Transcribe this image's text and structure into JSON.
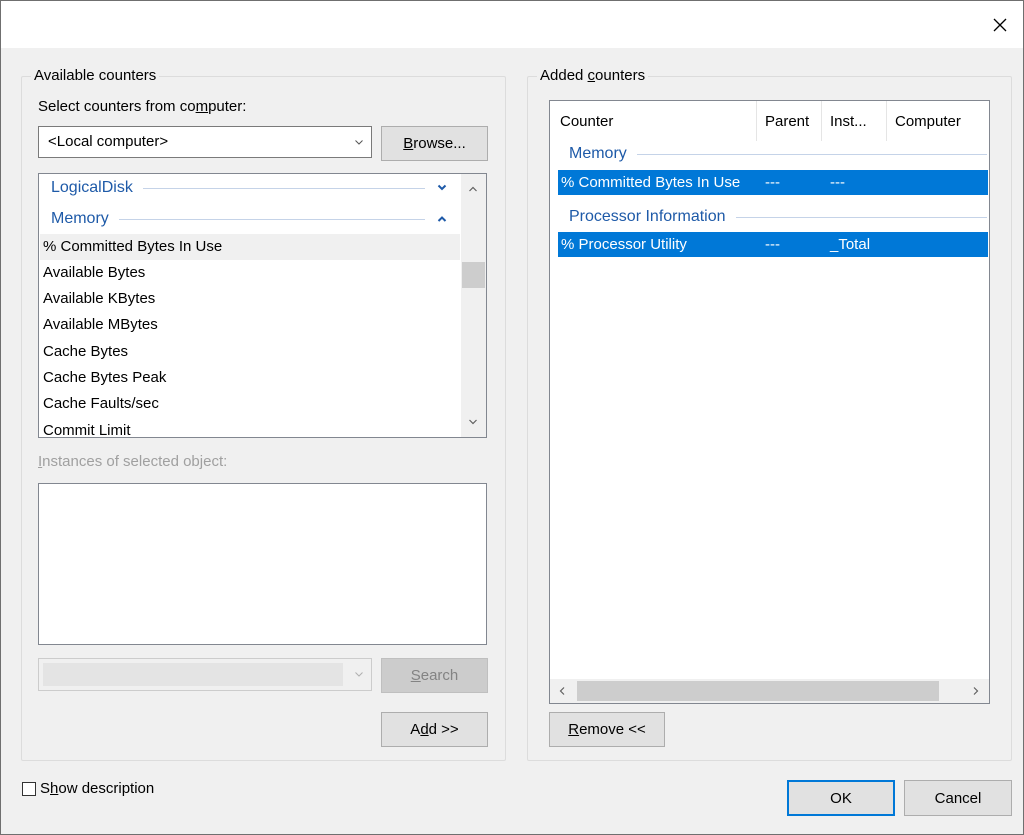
{
  "close_icon": "close-icon",
  "available": {
    "group_label": "Available counters",
    "select_label_pre": "Select counters from co",
    "select_label_ul": "m",
    "select_label_post": "puter:",
    "computer_value": "<Local computer>",
    "browse_pre": "",
    "browse_ul": "B",
    "browse_post": "rowse...",
    "groups": [
      {
        "name": "LogicalDisk",
        "chevron": "chevron-down-icon"
      },
      {
        "name": "Memory",
        "chevron": "chevron-up-icon"
      }
    ],
    "items": [
      "% Committed Bytes In Use",
      "Available Bytes",
      "Available KBytes",
      "Available MBytes",
      "Cache Bytes",
      "Cache Bytes Peak",
      "Cache Faults/sec",
      "Commit Limit"
    ],
    "instances_label_ul": "I",
    "instances_label_post": "nstances of selected object:",
    "search_label_pre": "",
    "search_label_ul": "S",
    "search_label_post": "earch",
    "add_label_pre": "A",
    "add_label_ul": "d",
    "add_label_post": "d >>"
  },
  "added": {
    "group_label_pre": "Added ",
    "group_label_ul": "c",
    "group_label_post": "ounters",
    "columns": [
      "Counter",
      "Parent",
      "Inst...",
      "Computer"
    ],
    "groups": [
      {
        "name": "Memory",
        "rows": [
          {
            "counter": "% Committed Bytes In Use",
            "parent": "---",
            "instance": "---",
            "computer": ""
          }
        ]
      },
      {
        "name": "Processor Information",
        "rows": [
          {
            "counter": "% Processor Utility",
            "parent": "---",
            "instance": "_Total",
            "computer": ""
          }
        ]
      }
    ],
    "remove_label_ul": "R",
    "remove_label_post": "emove <<"
  },
  "footer": {
    "show_description_pre": "S",
    "show_description_ul": "h",
    "show_description_post": "ow description",
    "ok_label": "OK",
    "cancel_label": "Cancel"
  },
  "colors": {
    "selection": "#0078d7",
    "group_header": "#1e5aa8"
  }
}
